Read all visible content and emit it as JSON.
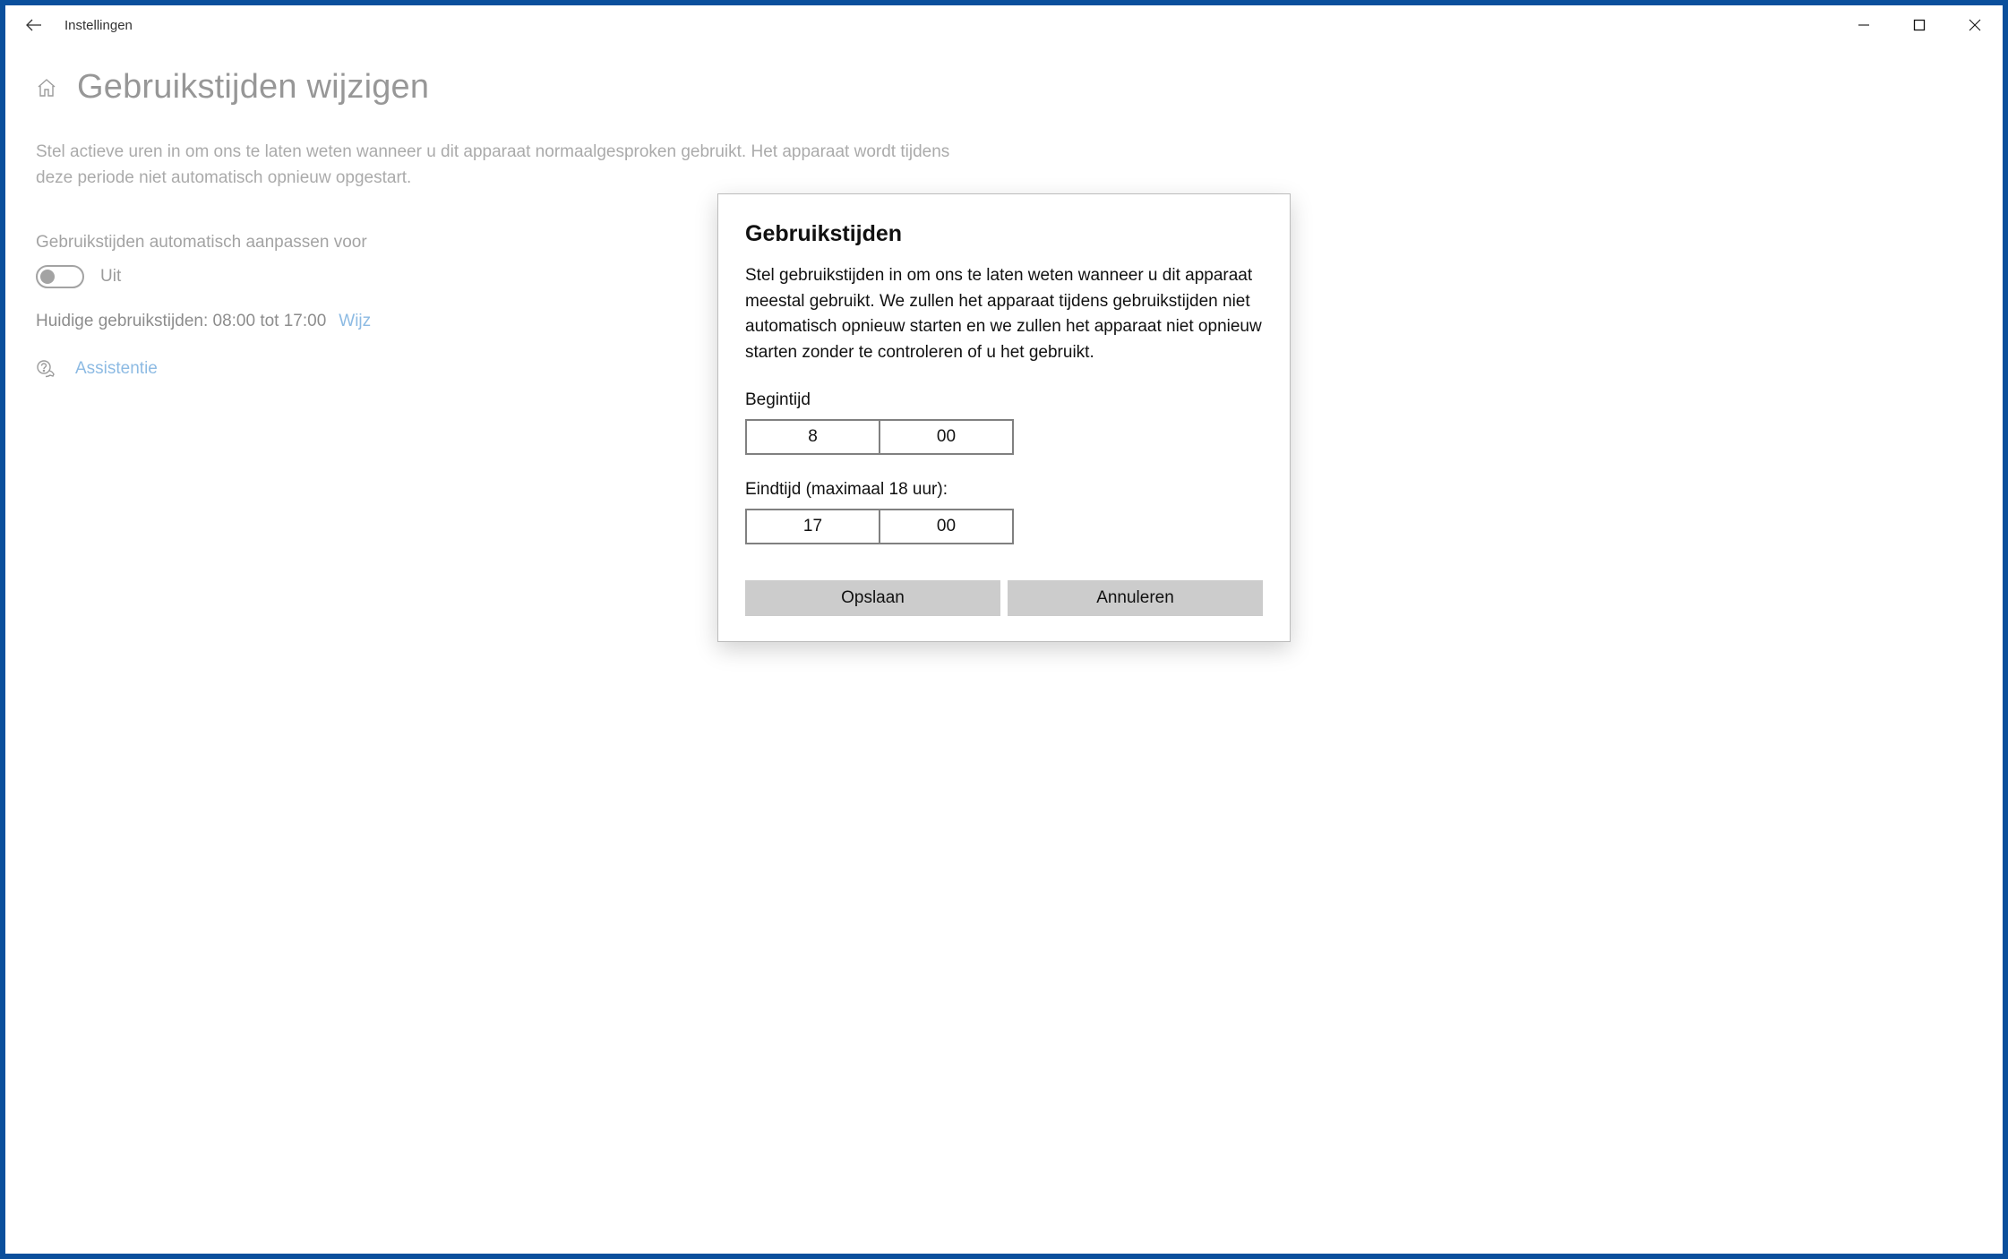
{
  "titlebar": {
    "app_name": "Instellingen"
  },
  "page": {
    "title": "Gebruikstijden wijzigen",
    "description": "Stel actieve uren in om ons te laten weten wanneer u dit apparaat normaalgesproken gebruikt. Het apparaat wordt tijdens deze periode niet automatisch opnieuw opgestart.",
    "auto_adjust_label": "Gebruikstijden automatisch aanpassen voor",
    "toggle_state": "Uit",
    "current_hours_text": "Huidige gebruikstijden: 08:00 tot 17:00",
    "change_link": "Wijz",
    "help_link": "Assistentie"
  },
  "dialog": {
    "title": "Gebruikstijden",
    "description": "Stel gebruikstijden in om ons te laten weten wanneer u dit apparaat meestal gebruikt. We zullen het apparaat tijdens gebruikstijden niet automatisch opnieuw starten en we zullen het apparaat niet opnieuw starten zonder te controleren of u het gebruikt.",
    "start_label": "Begintijd",
    "start_hour": "8",
    "start_minute": "00",
    "end_label": "Eindtijd (maximaal 18 uur):",
    "end_hour": "17",
    "end_minute": "00",
    "save_label": "Opslaan",
    "cancel_label": "Annuleren"
  }
}
